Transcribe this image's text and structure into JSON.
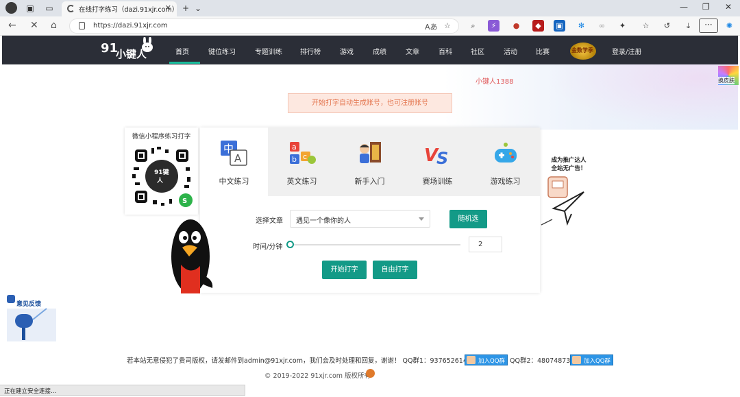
{
  "browser": {
    "tab_title": "在线打字练习（dazi.91xjr.com）",
    "new_tab_symbol": "+",
    "tab_list_symbol": "⌄",
    "window_min": "—",
    "window_max": "❐",
    "window_close": "✕",
    "url": "https://dazi.91xjr.com",
    "read_aloud_symbol": "Aあ",
    "favorite_symbol": "☆",
    "more_symbol": "···",
    "status_text": "正在建立安全连接..."
  },
  "site": {
    "nav_items": [
      {
        "label": "首页"
      },
      {
        "label": "键位练习"
      },
      {
        "label": "专题训练"
      },
      {
        "label": "排行榜"
      },
      {
        "label": "游戏"
      },
      {
        "label": "成绩"
      },
      {
        "label": "文章"
      },
      {
        "label": "百科"
      },
      {
        "label": "社区"
      },
      {
        "label": "活动"
      },
      {
        "label": "比赛"
      }
    ],
    "login_label": "登录/注册",
    "username": "小键人1388",
    "skin_label": "换皮肤",
    "notice": "开始打字自动生成账号，也可注册账号",
    "qr_title": "微信小程序练习打字",
    "accent_color": "#139a87"
  },
  "practice": {
    "tabs": [
      {
        "label": "中文练习",
        "icon": "chinese-icon"
      },
      {
        "label": "英文练习",
        "icon": "abc-blocks-icon"
      },
      {
        "label": "新手入门",
        "icon": "beginner-icon"
      },
      {
        "label": "赛场训练",
        "icon": "vs-icon"
      },
      {
        "label": "游戏练习",
        "icon": "gamepad-icon"
      }
    ],
    "article_label": "选择文章",
    "article_value": "遇见一个像你的人",
    "random_button": "随机选",
    "time_label": "时间/分钟",
    "time_value": "2",
    "time_slider_level": 0,
    "start_button": "开始打字",
    "free_button": "自由打字"
  },
  "promo": {
    "line1": "成为推广达人",
    "line2": "全站无广告！"
  },
  "feedback": {
    "label": "意见反馈"
  },
  "footer": {
    "line1": "若本站无意侵犯了贵司版权，请发邮件到admin@91xjr.com，我们会及时处理和回复，谢谢！ QQ群1：937652614",
    "qq_join_1": "加入QQ群",
    "line1b": "QQ群2：480748731",
    "qq_join_2": "加入QQ群",
    "copyright": "© 2019-2022 91xjr.com 版权所有"
  }
}
